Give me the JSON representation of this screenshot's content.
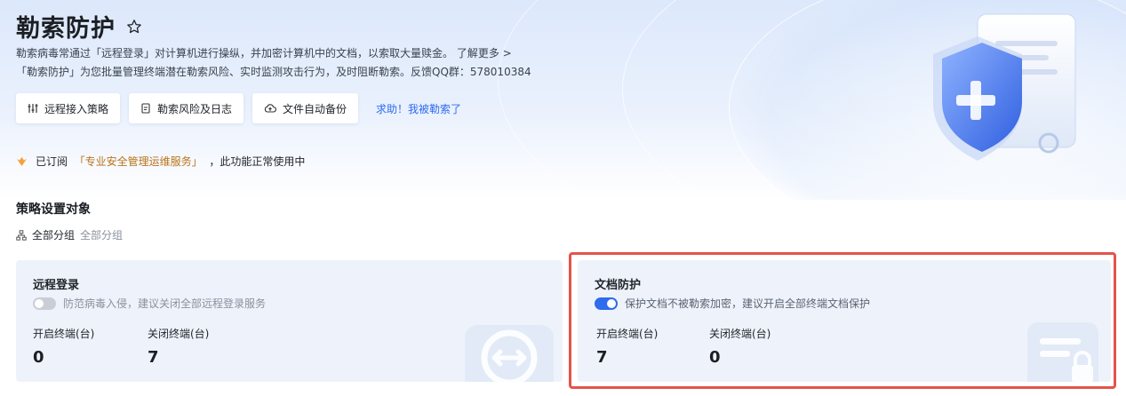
{
  "header": {
    "title": "勒索防护",
    "desc_line1": "勒索病毒常通过「远程登录」对计算机进行操纵，并加密计算机中的文档，以索取大量赎金。",
    "learn_more": "了解更多 >",
    "desc_line2": "「勒索防护」为您批量管理终端潜在勒索风险、实时监测攻击行为，及时阻断勒索。反馈QQ群：578010384"
  },
  "toolbar": {
    "remote_policy_label": "远程接入策略",
    "risk_log_label": "勒索风险及日志",
    "auto_backup_label": "文件自动备份",
    "help_link": "求助！我被勒索了"
  },
  "subscription": {
    "prefix": "已订阅",
    "service": "「专业安全管理运维服务」",
    "suffix": "，此功能正常使用中"
  },
  "policy": {
    "section_title": "策略设置对象",
    "group_name": "全部分组",
    "group_path": "全部分组"
  },
  "cards": [
    {
      "title": "远程登录",
      "toggle_on": false,
      "toggle_text": "防范病毒入侵，建议关闭全部远程登录服务",
      "enabled_label": "开启终端(台)",
      "enabled_value": "0",
      "disabled_label": "关闭终端(台)",
      "disabled_value": "7"
    },
    {
      "title": "文档防护",
      "toggle_on": true,
      "toggle_text": "保护文档不被勒索加密，建议开启全部终端文档保护",
      "enabled_label": "开启终端(台)",
      "enabled_value": "7",
      "disabled_label": "关闭终端(台)",
      "disabled_value": "0"
    }
  ],
  "colors": {
    "accent": "#2f6bed",
    "highlight_border": "#e5534b",
    "subscription_accent": "#b9741a"
  },
  "icons": [
    "star-icon",
    "policy-icon",
    "document-icon",
    "cloud-upload-icon",
    "crown-icon",
    "org-tree-icon",
    "remote-transfer-icon",
    "document-lock-icon",
    "shield-plus-icon"
  ]
}
